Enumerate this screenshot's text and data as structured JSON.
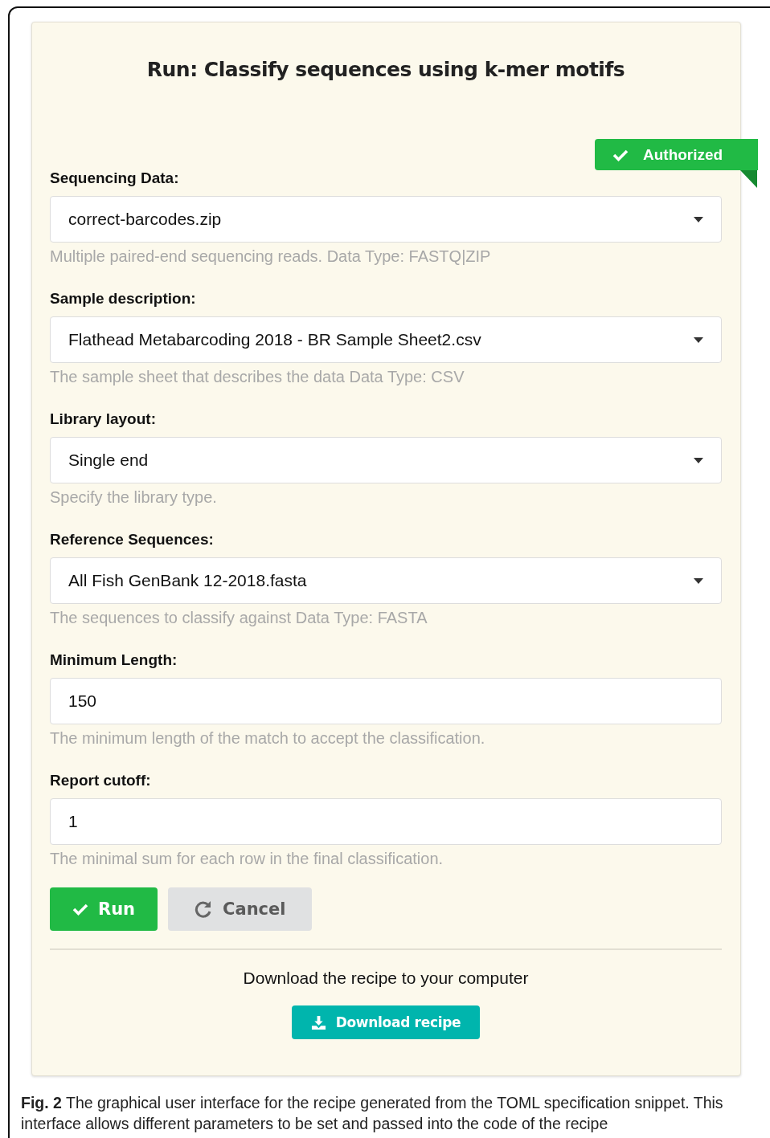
{
  "form": {
    "title": "Run: Classify sequences using k-mer motifs",
    "badge": "Authorized",
    "fields": [
      {
        "kind": "select",
        "label": "Sequencing Data:",
        "value": "correct-barcodes.zip",
        "help": "Multiple paired-end sequencing reads. Data Type: FASTQ|ZIP"
      },
      {
        "kind": "select",
        "label": "Sample description:",
        "value": "Flathead Metabarcoding 2018 - BR Sample Sheet2.csv",
        "help": "The sample sheet that describes the data Data Type: CSV"
      },
      {
        "kind": "select",
        "label": "Library layout:",
        "value": "Single end",
        "help": "Specify the library type."
      },
      {
        "kind": "select",
        "label": "Reference Sequences:",
        "value": "All Fish GenBank 12-2018.fasta",
        "help": "The sequences to classify against Data Type: FASTA"
      },
      {
        "kind": "text",
        "label": "Minimum Length:",
        "value": "150",
        "help": "The minimum length of the match to accept the classification."
      },
      {
        "kind": "text",
        "label": "Report cutoff:",
        "value": "1",
        "help": "The minimal sum for each row in the final classification."
      }
    ],
    "buttons": [
      {
        "kind": "run",
        "label": "Run"
      },
      {
        "kind": "cancel",
        "label": "Cancel"
      }
    ],
    "download_text": "Download the recipe to your computer",
    "download_button": "Download recipe"
  },
  "caption": "**Fig. 2** The graphical user interface for the recipe generated from the TOML specification snippet. This interface allows different parameters to be set and passed into the code of the recipe"
}
